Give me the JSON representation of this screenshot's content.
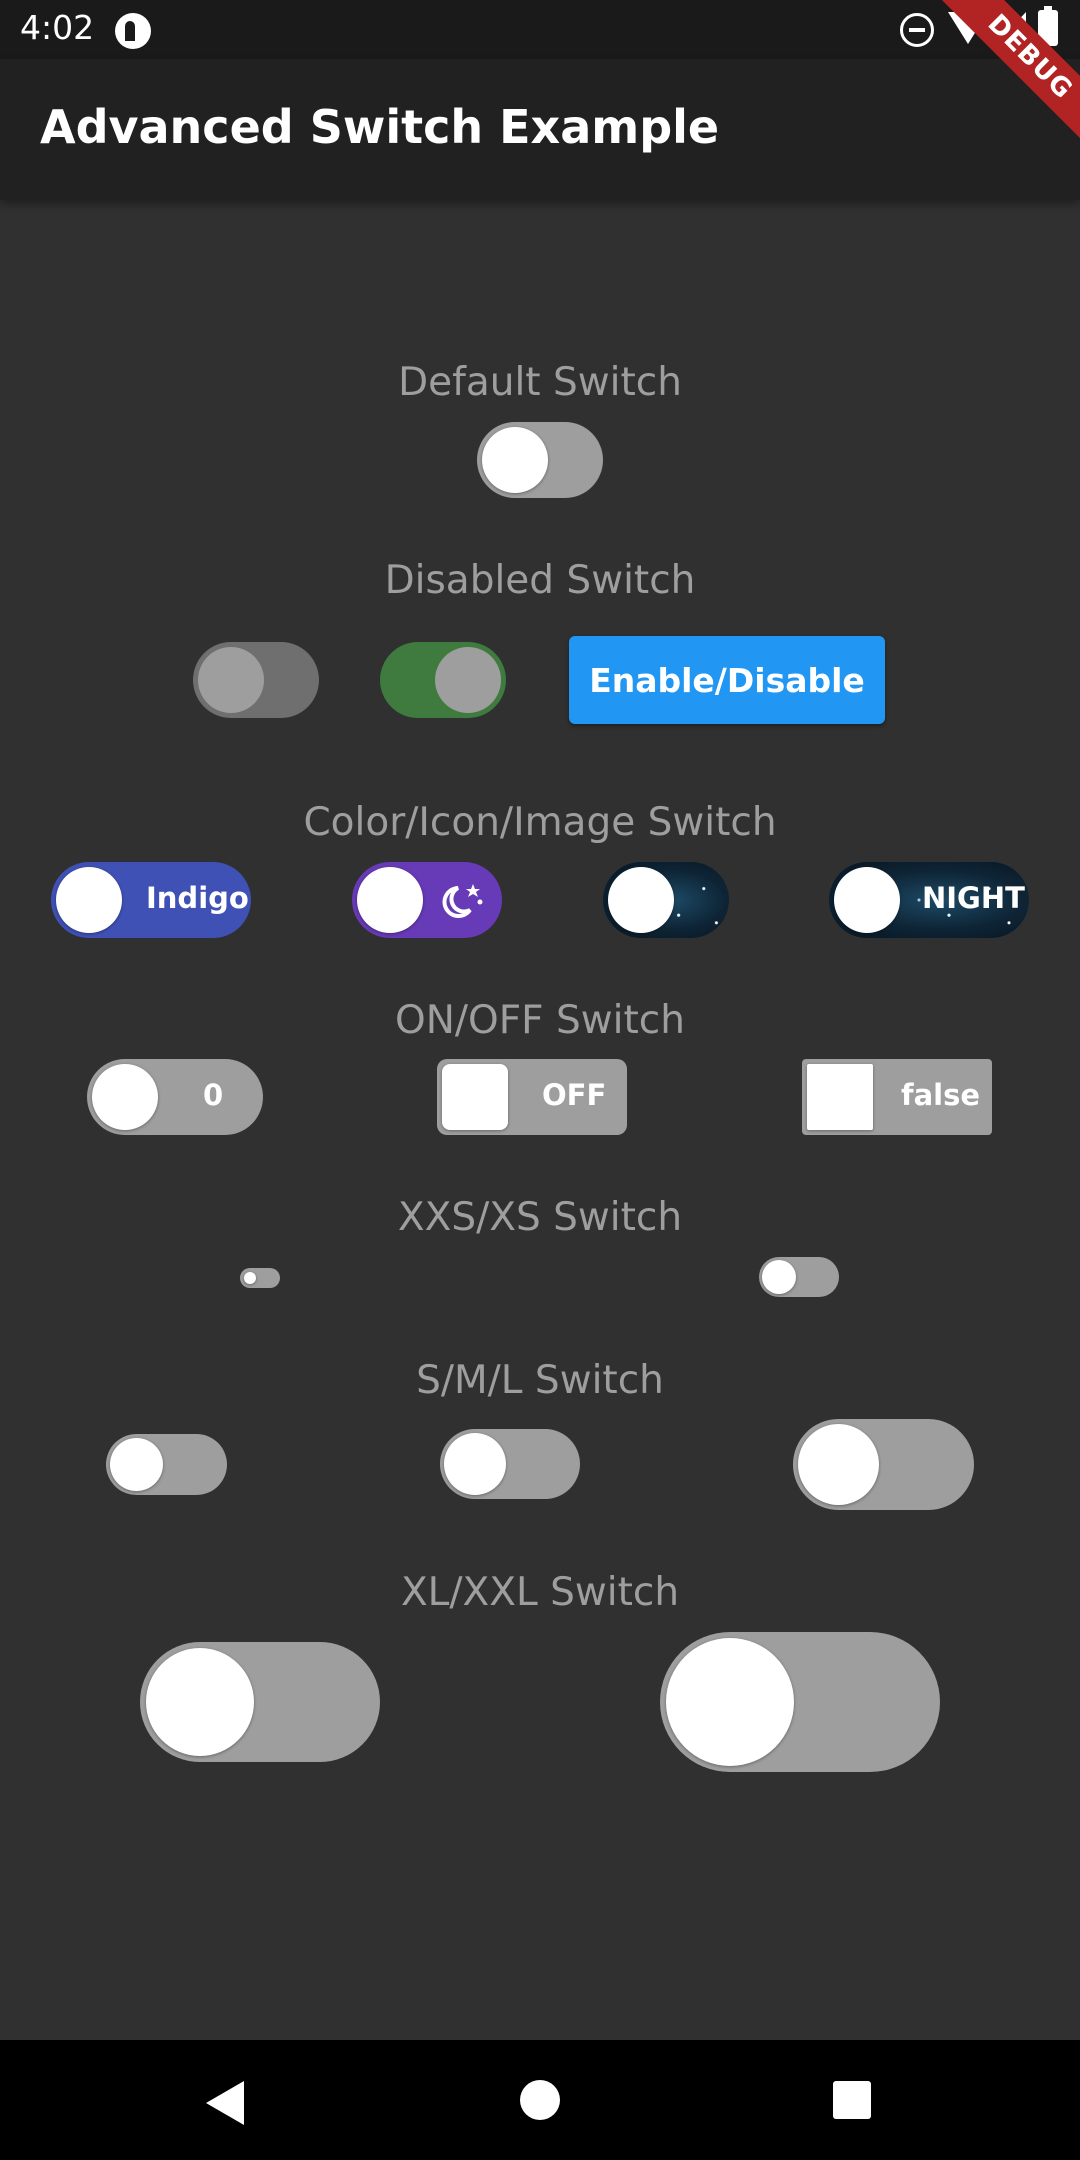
{
  "status_bar": {
    "time": "4:02"
  },
  "app_bar": {
    "title": "Advanced Switch Example"
  },
  "debug_banner": "DEBUG",
  "sections": {
    "default": {
      "title": "Default Switch"
    },
    "disabled": {
      "title": "Disabled Switch",
      "button_label": "Enable/Disable"
    },
    "color": {
      "title": "Color/Icon/Image Switch",
      "indigo_label": "Indigo",
      "night_label": "NIGHT"
    },
    "onoff": {
      "title": "ON/OFF Switch",
      "label_zero": "0",
      "label_off": "OFF",
      "label_false": "false"
    },
    "xxs": {
      "title": "XXS/XS Switch"
    },
    "sml": {
      "title": "S/M/L Switch"
    },
    "xl": {
      "title": "XL/XXL Switch"
    }
  },
  "colors": {
    "background": "#303030",
    "app_bar": "#212121",
    "track_off": "#9e9e9e",
    "disabled_on": "#3f7a3f",
    "indigo": "#3f51b5",
    "purple": "#673ab7",
    "button": "#2196f3"
  },
  "icons": [
    "moon-stars-icon"
  ]
}
